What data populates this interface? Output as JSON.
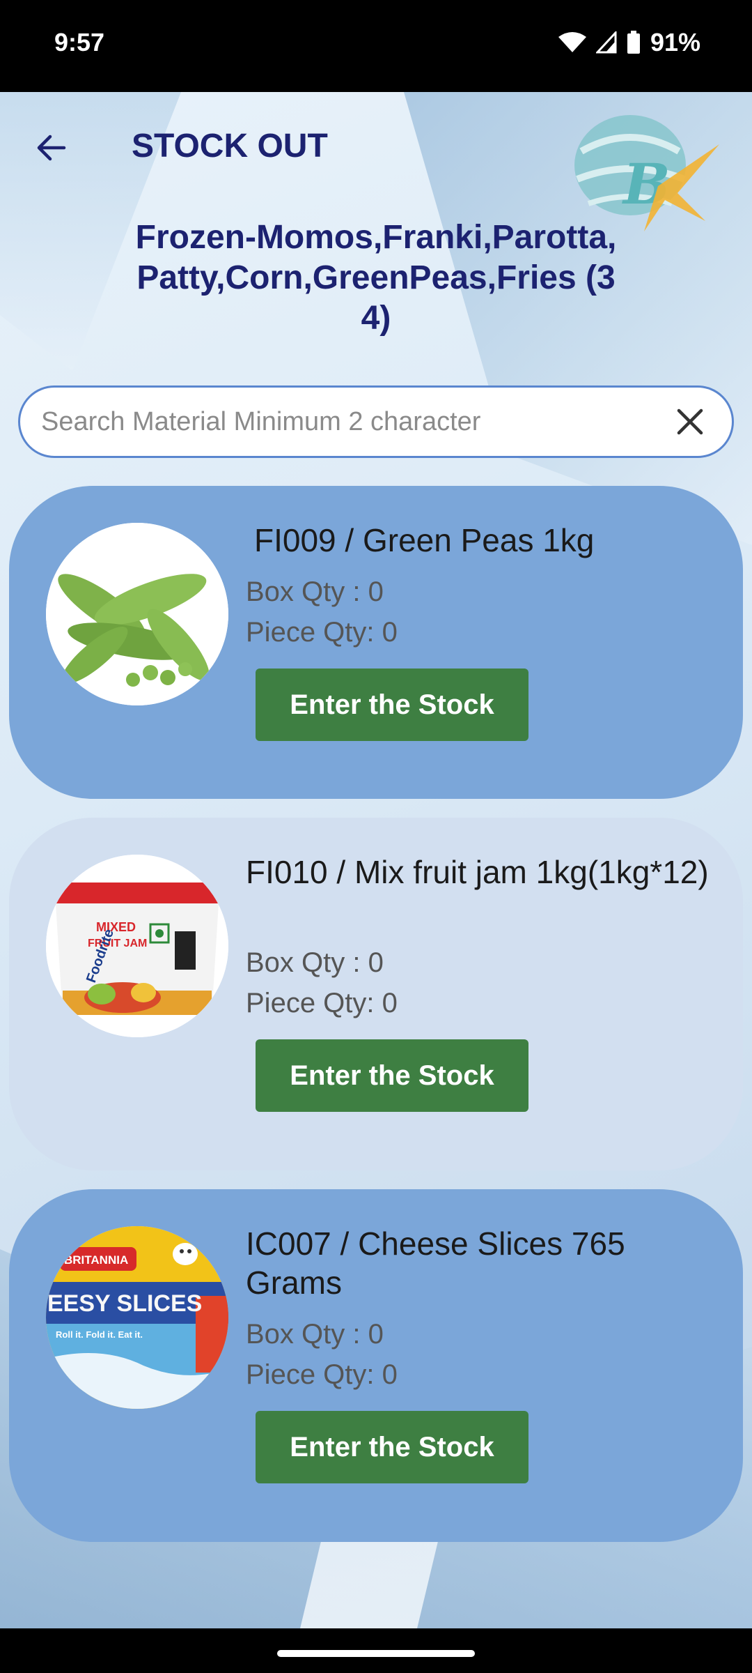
{
  "status_bar": {
    "time": "9:57",
    "battery": "91%"
  },
  "header": {
    "title": "STOCK OUT"
  },
  "category": {
    "title": "Frozen-Momos,Franki,Parotta,Patty,Corn,GreenPeas,Fries (34)"
  },
  "search": {
    "placeholder": "Search Material Minimum 2 character",
    "value": ""
  },
  "colors": {
    "card_blue": "#7ba6d9",
    "card_light": "#d2dff0",
    "button_green": "#3e7f42",
    "title_navy": "#1c2270"
  },
  "products": [
    {
      "name": "FI009 /  Green Peas 1kg",
      "box_qty": "Box Qty : 0",
      "piece_qty": "Piece Qty: 0",
      "button_label": "Enter the Stock",
      "image_icon": "green-peas-image"
    },
    {
      "name": "FI010 /  Mix fruit jam 1kg(1kg*12)",
      "box_qty": "Box Qty : 0",
      "piece_qty": "Piece Qty: 0",
      "button_label": "Enter the Stock",
      "image_icon": "fruit-jam-image",
      "image_text": [
        "MIXED",
        "FRUIT JAM",
        "Foodrite"
      ]
    },
    {
      "name": "IC007 /  Cheese Slices 765 Grams",
      "box_qty": "Box Qty : 0",
      "piece_qty": "Piece Qty: 0",
      "button_label": "Enter the Stock",
      "image_icon": "cheese-slices-image",
      "image_text": [
        "BRITANNIA",
        "EESY SLICES",
        "Roll it. Fold it. Eat it."
      ]
    }
  ]
}
